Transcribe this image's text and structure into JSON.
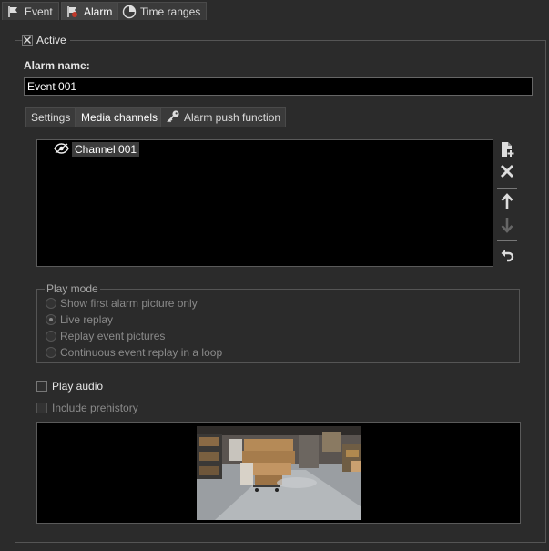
{
  "top_tabs": [
    {
      "label": "Event",
      "icon": "flag-icon"
    },
    {
      "label": "Alarm",
      "icon": "alarm-flag-icon",
      "active": true
    },
    {
      "label": "Time ranges",
      "icon": "pie-clock-icon"
    }
  ],
  "active": {
    "label": "Active",
    "checked": true
  },
  "alarm_name": {
    "label": "Alarm name:",
    "value": "Event 001"
  },
  "sub_tabs": [
    {
      "label": "Settings"
    },
    {
      "label": "Media channels",
      "active": true
    },
    {
      "label": "Alarm push function",
      "icon": "key-icon"
    }
  ],
  "channels": [
    {
      "label": "Channel 001",
      "icon": "eye-icon"
    }
  ],
  "toolbar": [
    {
      "name": "add-channel-button",
      "icon": "add-document-icon"
    },
    {
      "name": "remove-channel-button",
      "icon": "close-icon"
    },
    {
      "name": "move-up-button",
      "icon": "arrow-up-icon"
    },
    {
      "name": "move-down-button",
      "icon": "arrow-down-icon",
      "disabled": true
    },
    {
      "name": "undo-button",
      "icon": "undo-icon"
    }
  ],
  "play_mode": {
    "legend": "Play mode",
    "options": [
      {
        "label": "Show first alarm picture only",
        "selected": false
      },
      {
        "label": "Live replay",
        "selected": true
      },
      {
        "label": "Replay event pictures",
        "selected": false
      },
      {
        "label": "Continuous event replay in a loop",
        "selected": false
      }
    ]
  },
  "play_audio": {
    "label": "Play audio",
    "checked": false
  },
  "include_prehistory": {
    "label": "Include prehistory",
    "checked": false,
    "disabled": true
  },
  "colors": {
    "background": "#2b2b2b",
    "list_background": "#000000",
    "text": "#e6e6e6",
    "disabled_text": "#8a8a8a"
  }
}
